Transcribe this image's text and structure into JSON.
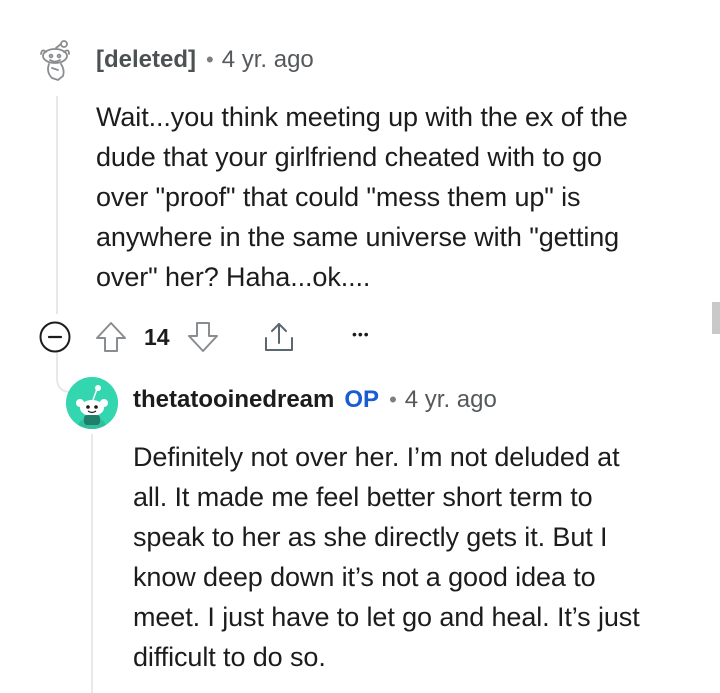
{
  "comments": [
    {
      "author": "[deleted]",
      "separator": "•",
      "age": "4 yr. ago",
      "body": "Wait...you think meeting up with the ex of the\ndude that your girlfriend cheated with to go\nover \"proof\" that could \"mess them up\" is\nanywhere in the same universe with \"getting\nover\" her? Haha...ok....",
      "score": "14",
      "collapse_icon": "collapse-icon",
      "upvote_icon": "upvote-icon",
      "downvote_icon": "downvote-icon",
      "share_icon": "share-icon",
      "more_icon": "more-options-icon",
      "more_label": "•••"
    },
    {
      "author": "thetatooinedream",
      "op_badge": "OP",
      "separator": "•",
      "age": "4 yr. ago",
      "body": "Definitely not over her. I’m not deluded at\nall. It made me feel better short term to\nspeak to her as she directly gets it. But I\nknow deep down it’s not a good idea to\nmeet. I just have to let go and heal. It’s just\ndifficult to do so."
    }
  ],
  "colors": {
    "avatar_teal": "#34d6b0",
    "op_blue": "#1a5cd1",
    "thread_line": "#e6e8ea"
  }
}
